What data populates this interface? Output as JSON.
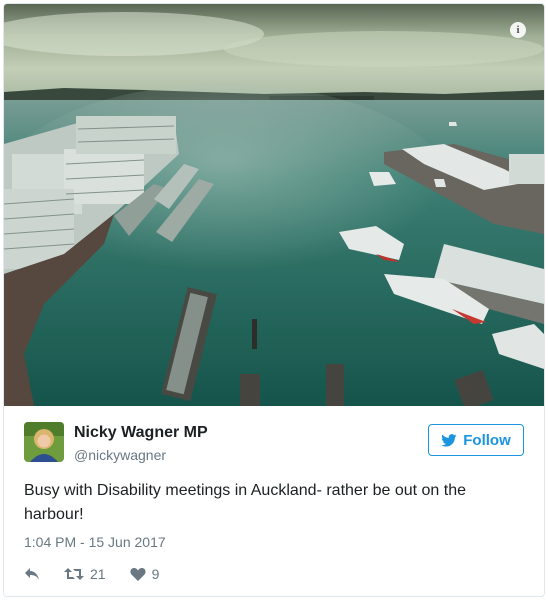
{
  "tweet": {
    "author_name": "Nicky Wagner MP",
    "author_handle": "@nickywagner",
    "follow_label": "Follow",
    "text": "Busy with Disability meetings in Auckland- rather be out on the harbour!",
    "timestamp": "1:04 PM - 15 Jun 2017",
    "retweet_count": "21",
    "like_count": "9"
  },
  "icons": {
    "info": "info-icon",
    "reply": "reply-icon",
    "retweet": "retweet-icon",
    "like": "heart-icon",
    "follow_bird": "twitter-bird-icon"
  },
  "colors": {
    "accent": "#1b95e0",
    "muted": "#697882",
    "text": "#1c2022",
    "border": "#e1e8ed"
  }
}
